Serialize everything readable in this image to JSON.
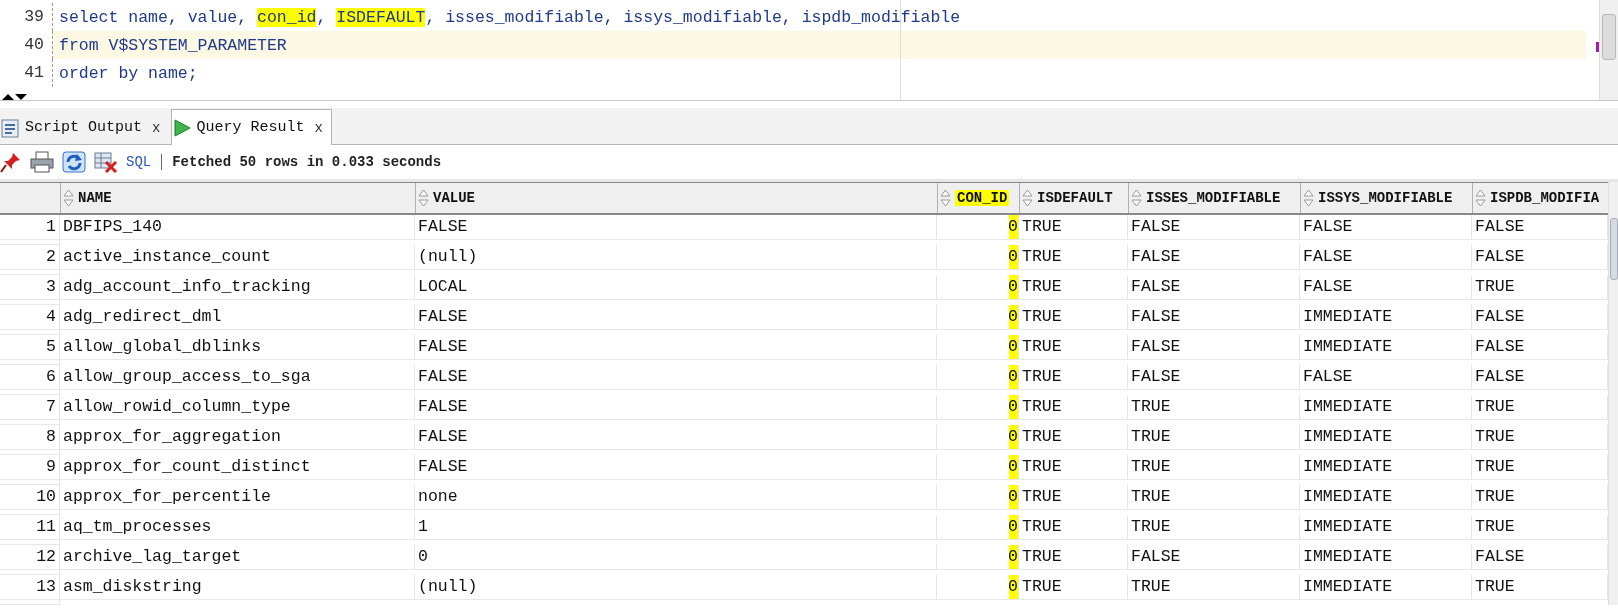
{
  "editor": {
    "lines": [
      {
        "number": "39",
        "current": false,
        "segments": [
          {
            "text": "select name, value, ",
            "highlighted": false
          },
          {
            "text": "con_id",
            "highlighted": true
          },
          {
            "text": ", ",
            "highlighted": false
          },
          {
            "text": "ISDEFAULT",
            "highlighted": true
          },
          {
            "text": ", isses_modifiable, issys_modifiable, ispdb_modifiable",
            "highlighted": false
          }
        ]
      },
      {
        "number": "40",
        "current": true,
        "segments": [
          {
            "text": "from V$SYSTEM_PARAMETER",
            "highlighted": false
          }
        ]
      },
      {
        "number": "41",
        "current": false,
        "segments": [
          {
            "text": "order by name;",
            "highlighted": false
          }
        ]
      }
    ]
  },
  "tabs": [
    {
      "label": "Script Output",
      "close": "x",
      "selected": false,
      "kind": "script"
    },
    {
      "label": "Query Result",
      "close": "x",
      "selected": true,
      "kind": "query"
    }
  ],
  "toolbar": {
    "sql_label": "SQL",
    "status": "Fetched 50 rows in 0.033 seconds"
  },
  "table": {
    "columns": [
      {
        "label": "NAME",
        "highlighted": false
      },
      {
        "label": "VALUE",
        "highlighted": false
      },
      {
        "label": "CON_ID",
        "highlighted": true
      },
      {
        "label": "ISDEFAULT",
        "highlighted": false
      },
      {
        "label": "ISSES_MODIFIABLE",
        "highlighted": false
      },
      {
        "label": "ISSYS_MODIFIABLE",
        "highlighted": false
      },
      {
        "label": "ISPDB_MODIFIA",
        "highlighted": false
      }
    ],
    "rows": [
      {
        "number": "1",
        "cells": [
          "DBFIPS_140",
          "FALSE",
          "0",
          "TRUE",
          "FALSE",
          "FALSE",
          "FALSE"
        ]
      },
      {
        "number": "2",
        "cells": [
          "active_instance_count",
          "(null)",
          "0",
          "TRUE",
          "FALSE",
          "FALSE",
          "FALSE"
        ]
      },
      {
        "number": "3",
        "cells": [
          "adg_account_info_tracking",
          "LOCAL",
          "0",
          "TRUE",
          "FALSE",
          "FALSE",
          "TRUE"
        ]
      },
      {
        "number": "4",
        "cells": [
          "adg_redirect_dml",
          "FALSE",
          "0",
          "TRUE",
          "FALSE",
          "IMMEDIATE",
          "FALSE"
        ]
      },
      {
        "number": "5",
        "cells": [
          "allow_global_dblinks",
          "FALSE",
          "0",
          "TRUE",
          "FALSE",
          "IMMEDIATE",
          "FALSE"
        ]
      },
      {
        "number": "6",
        "cells": [
          "allow_group_access_to_sga",
          "FALSE",
          "0",
          "TRUE",
          "FALSE",
          "FALSE",
          "FALSE"
        ]
      },
      {
        "number": "7",
        "cells": [
          "allow_rowid_column_type",
          "FALSE",
          "0",
          "TRUE",
          "TRUE",
          "IMMEDIATE",
          "TRUE"
        ]
      },
      {
        "number": "8",
        "cells": [
          "approx_for_aggregation",
          "FALSE",
          "0",
          "TRUE",
          "TRUE",
          "IMMEDIATE",
          "TRUE"
        ]
      },
      {
        "number": "9",
        "cells": [
          "approx_for_count_distinct",
          "FALSE",
          "0",
          "TRUE",
          "TRUE",
          "IMMEDIATE",
          "TRUE"
        ]
      },
      {
        "number": "10",
        "cells": [
          "approx_for_percentile",
          "none",
          "0",
          "TRUE",
          "TRUE",
          "IMMEDIATE",
          "TRUE"
        ]
      },
      {
        "number": "11",
        "cells": [
          "aq_tm_processes",
          "1",
          "0",
          "TRUE",
          "TRUE",
          "IMMEDIATE",
          "TRUE"
        ]
      },
      {
        "number": "12",
        "cells": [
          "archive_lag_target",
          "0",
          "0",
          "TRUE",
          "FALSE",
          "IMMEDIATE",
          "FALSE"
        ]
      },
      {
        "number": "13",
        "cells": [
          "asm_diskstring",
          "(null)",
          "0",
          "TRUE",
          "TRUE",
          "IMMEDIATE",
          "TRUE"
        ]
      }
    ]
  }
}
